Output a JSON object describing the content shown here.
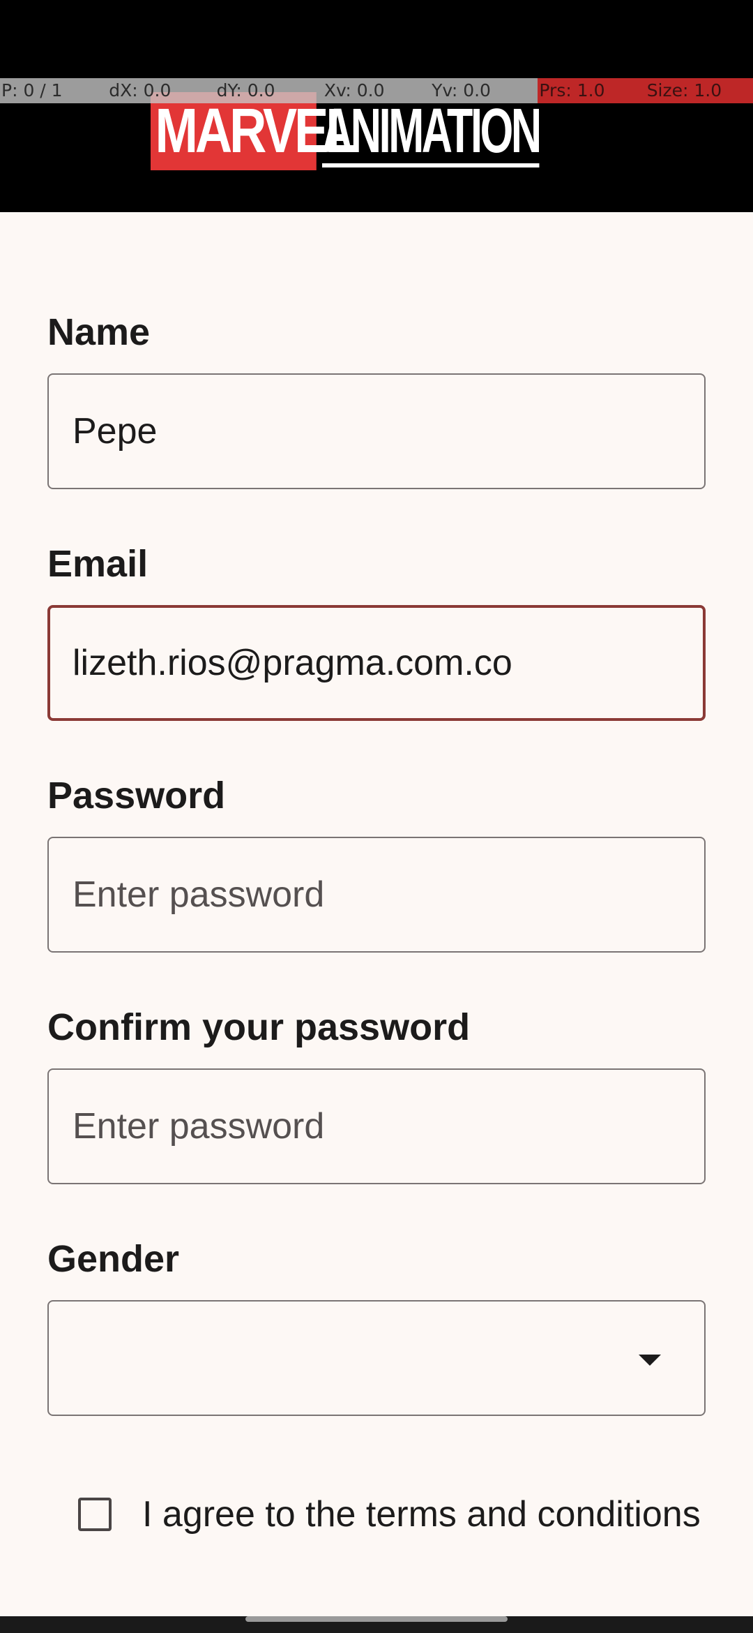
{
  "debug_overlay": {
    "cells": [
      "P: 0 / 1",
      "dX: 0.0",
      "dY: 0.0",
      "Xv: 0.0",
      "Yv: 0.0",
      "Prs: 1.0",
      "Size: 1.0"
    ]
  },
  "header": {
    "logo_word1": "MARVEL",
    "logo_word2": "ANIMATION"
  },
  "form": {
    "name_label": "Name",
    "name_value": "Pepe",
    "email_label": "Email",
    "email_value": "lizeth.rios@pragma.com.co",
    "password_label": "Password",
    "password_placeholder": "Enter password",
    "confirm_label": "Confirm your password",
    "confirm_placeholder": "Enter password",
    "gender_label": "Gender",
    "gender_value": "",
    "terms_label": "I agree to the terms and conditions",
    "terms_checked": false
  },
  "colors": {
    "background": "#fdf8f5",
    "header": "#000000",
    "focused_border": "#8b3a36",
    "logo_red": "#e23636"
  },
  "icons": {
    "gender_dropdown": "chevron-down-icon",
    "terms_checkbox": "checkbox-unchecked-icon"
  }
}
